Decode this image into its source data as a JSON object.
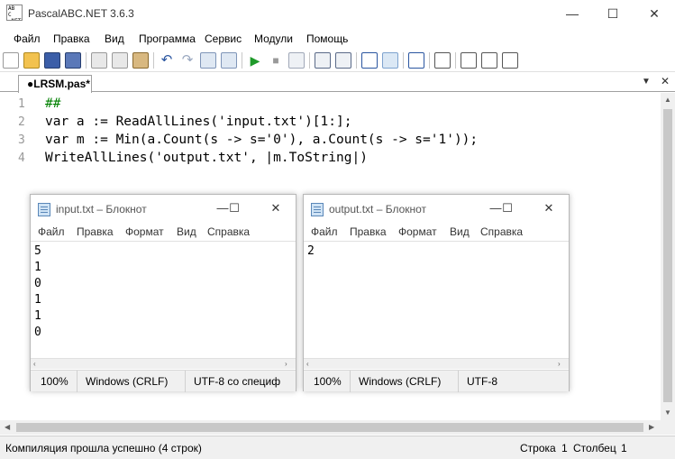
{
  "app": {
    "title": "PascalABC.NET 3.6.3",
    "icon_text": "AB\nC\n.NET"
  },
  "window_controls": {
    "minimize": "—",
    "maximize": "☐",
    "close": "✕"
  },
  "menu": [
    "Файл",
    "Правка",
    "Вид",
    "Программа",
    "Сервис",
    "Модули",
    "Помощь"
  ],
  "toolbar": {
    "icons": [
      "new-file-icon",
      "open-icon",
      "save-icon",
      "save-all-icon",
      "cut-icon",
      "copy-icon",
      "paste-icon",
      "undo-icon",
      "redo-icon",
      "find-icon",
      "replace-icon",
      "run-icon",
      "stop-icon",
      "step-over-icon",
      "step-into-icon",
      "output-window-icon",
      "console-icon",
      "debug-icon",
      "form-designer-icon",
      "module-icon",
      "format-icon",
      "code-completion-icon"
    ]
  },
  "tab": {
    "label": "●LRSM.pas*"
  },
  "editor": {
    "line_numbers": [
      "1",
      "2",
      "3",
      "4"
    ],
    "lines": [
      "##",
      "var a := ReadAllLines('input.txt')[1:];",
      "var m := Min(a.Count(s -> s='0'), a.Count(s -> s='1'));",
      "WriteAllLines('output.txt', |m.ToString|)"
    ]
  },
  "statusbar": {
    "message": "Компиляция прошла успешно (4 строк)",
    "row_label": "Строка",
    "row_value": "1",
    "col_label": "Столбец",
    "col_value": "1"
  },
  "notepad_input": {
    "title": "input.txt – Блокнот",
    "menu": [
      "Файл",
      "Правка",
      "Формат",
      "Вид",
      "Справка"
    ],
    "lines": [
      "5",
      "1",
      "0",
      "1",
      "1",
      "0"
    ],
    "zoom": "100%",
    "line_ending": "Windows (CRLF)",
    "encoding": "UTF-8 со специф"
  },
  "notepad_output": {
    "title": "output.txt – Блокнот",
    "menu": [
      "Файл",
      "Правка",
      "Формат",
      "Вид",
      "Справка"
    ],
    "lines": [
      "2"
    ],
    "zoom": "100%",
    "line_ending": "Windows (CRLF)",
    "encoding": "UTF-8"
  },
  "colors": {
    "keyword": "#000000",
    "string": "#1a1a8c",
    "comment": "#008000",
    "gutter_text": "#999999"
  }
}
